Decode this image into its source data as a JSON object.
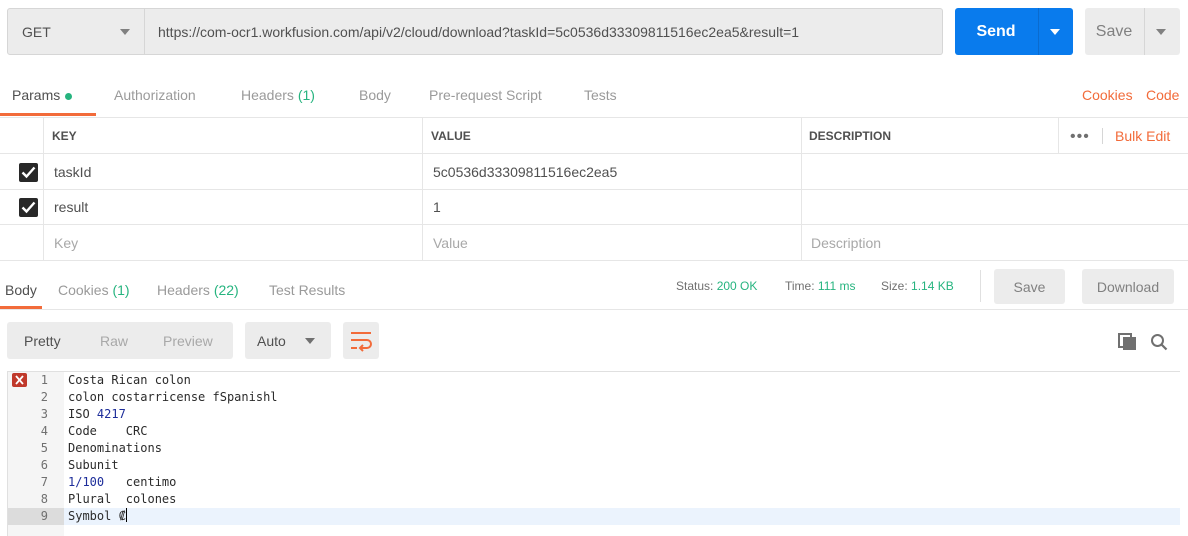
{
  "request": {
    "method": "GET",
    "url": "https://com-ocr1.workfusion.com/api/v2/cloud/download?taskId=5c0536d33309811516ec2ea5&result=1",
    "send_label": "Send",
    "save_label": "Save"
  },
  "request_tabs": {
    "params": "Params",
    "authorization": "Authorization",
    "headers": "Headers",
    "headers_count": "(1)",
    "body": "Body",
    "prerequest": "Pre-request Script",
    "tests": "Tests",
    "cookies": "Cookies",
    "code": "Code"
  },
  "params_table": {
    "headers": {
      "key": "KEY",
      "value": "VALUE",
      "description": "DESCRIPTION",
      "more": "•••",
      "bulk_edit": "Bulk Edit"
    },
    "rows": [
      {
        "checked": true,
        "key": "taskId",
        "value": "5c0536d33309811516ec2ea5",
        "description": ""
      },
      {
        "checked": true,
        "key": "result",
        "value": "1",
        "description": ""
      }
    ],
    "placeholders": {
      "key": "Key",
      "value": "Value",
      "description": "Description"
    }
  },
  "response_tabs": {
    "body": "Body",
    "cookies": "Cookies",
    "cookies_count": "(1)",
    "headers": "Headers",
    "headers_count": "(22)",
    "test_results": "Test Results"
  },
  "response_status": {
    "status_label": "Status:",
    "status_value": "200 OK",
    "time_label": "Time:",
    "time_value": "111 ms",
    "size_label": "Size:",
    "size_value": "1.14 KB",
    "save_label": "Save",
    "download_label": "Download"
  },
  "body_toolbar": {
    "views": [
      "Pretty",
      "Raw",
      "Preview"
    ],
    "active_view": "Pretty",
    "format": "Auto",
    "icons": [
      "wrap-lines-icon",
      "copy-icon",
      "search-icon"
    ]
  },
  "response_body": {
    "lines": [
      {
        "n": "1",
        "text": "Costa Rican colon"
      },
      {
        "n": "2",
        "text": "colon costarricense fSpanishl"
      },
      {
        "n": "3",
        "pre": "ISO ",
        "num": "4217",
        "post": ""
      },
      {
        "n": "4",
        "text": "Code    CRC"
      },
      {
        "n": "5",
        "text": "Denominations"
      },
      {
        "n": "6",
        "text": "Subunit"
      },
      {
        "n": "7",
        "pre": "",
        "num": "1/100",
        "post": "   centimo"
      },
      {
        "n": "8",
        "text": "Plural  colones"
      },
      {
        "n": "9",
        "text": "Symbol ₡"
      }
    ],
    "error_line": 1,
    "active_line": 9
  },
  "colors": {
    "accent": "#f26b3a",
    "primary": "#097bed",
    "success": "#26b47f",
    "error": "#c0392b"
  }
}
